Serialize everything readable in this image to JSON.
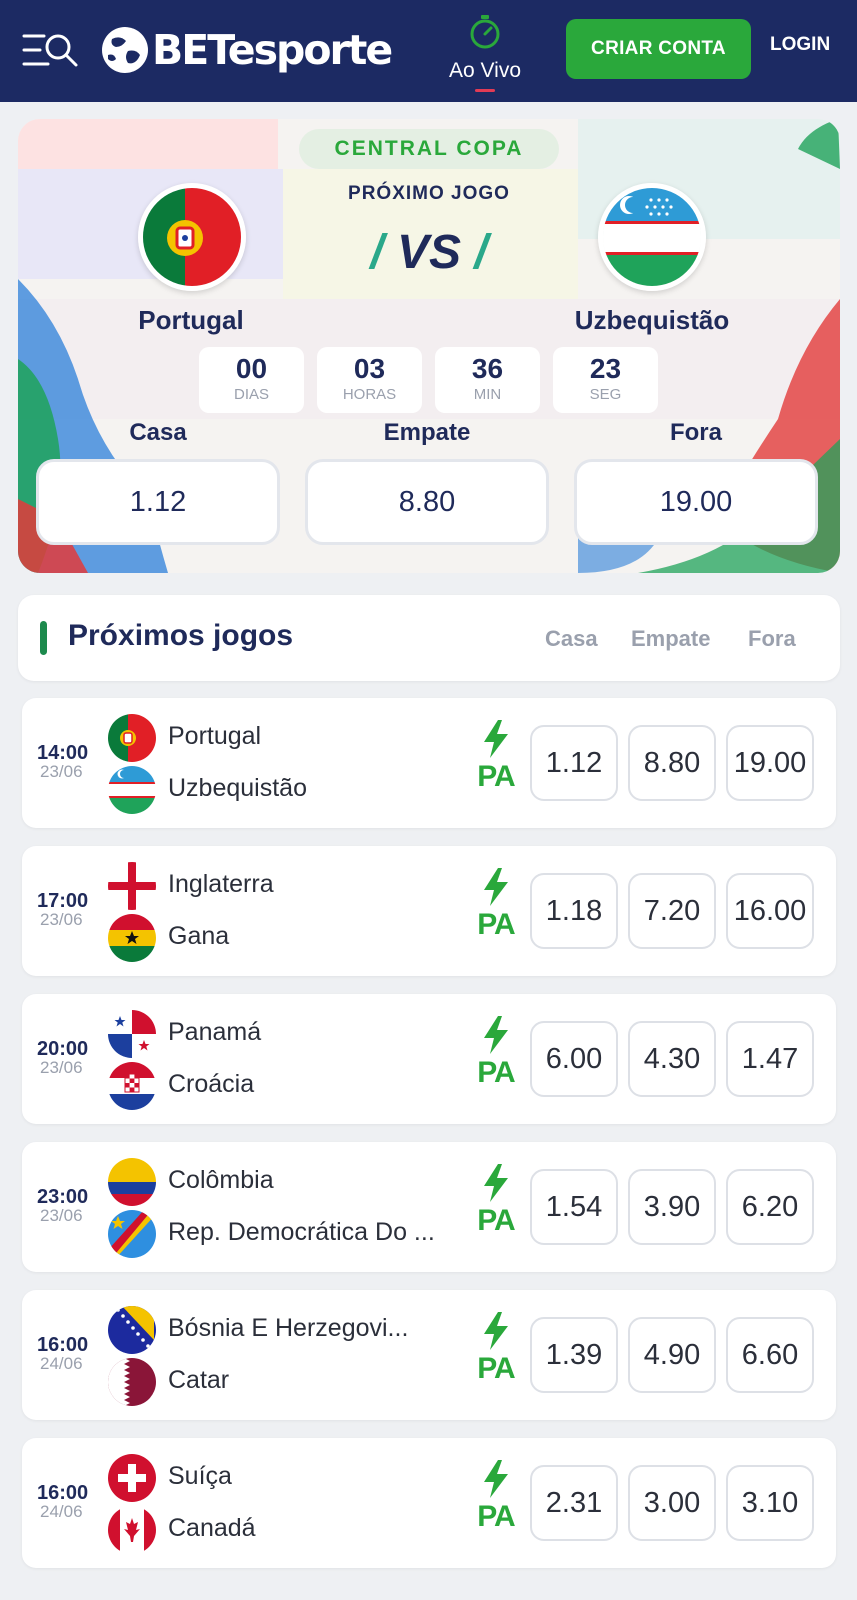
{
  "header": {
    "brand": "BETesporte",
    "live_label": "Ao Vivo",
    "create_account_label": "CRIAR CONTA",
    "login_label": "LOGIN",
    "menu_icon": "menu-search-icon",
    "live_icon": "stopwatch-icon"
  },
  "hero": {
    "badge": "CENTRAL COPA",
    "subtitle": "PRÓXIMO JOGO",
    "vs": "VS",
    "home_team": "Portugal",
    "away_team": "Uzbequistão",
    "countdown": [
      {
        "value": "00",
        "unit": "DIAS"
      },
      {
        "value": "03",
        "unit": "HORAS"
      },
      {
        "value": "36",
        "unit": "MIN"
      },
      {
        "value": "23",
        "unit": "SEG"
      }
    ],
    "odds": [
      {
        "label": "Casa",
        "value": "1.12"
      },
      {
        "label": "Empate",
        "value": "8.80"
      },
      {
        "label": "Fora",
        "value": "19.00"
      }
    ]
  },
  "upcoming": {
    "title": "Próximos jogos",
    "columns": [
      "Casa",
      "Empate",
      "Fora"
    ],
    "pa_label": "PA",
    "matches": [
      {
        "time": "14:00",
        "date": "23/06",
        "home": "Portugal",
        "away": "Uzbequistão",
        "home_flag": "portugal",
        "away_flag": "uzbekistan",
        "odds": [
          "1.12",
          "8.80",
          "19.00"
        ]
      },
      {
        "time": "17:00",
        "date": "23/06",
        "home": "Inglaterra",
        "away": "Gana",
        "home_flag": "england",
        "away_flag": "ghana",
        "odds": [
          "1.18",
          "7.20",
          "16.00"
        ]
      },
      {
        "time": "20:00",
        "date": "23/06",
        "home": "Panamá",
        "away": "Croácia",
        "home_flag": "panama",
        "away_flag": "croatia",
        "odds": [
          "6.00",
          "4.30",
          "1.47"
        ]
      },
      {
        "time": "23:00",
        "date": "23/06",
        "home": "Colômbia",
        "away": "Rep. Democrática Do ...",
        "home_flag": "colombia",
        "away_flag": "dr-congo",
        "odds": [
          "1.54",
          "3.90",
          "6.20"
        ]
      },
      {
        "time": "16:00",
        "date": "24/06",
        "home": "Bósnia E Herzegovi...",
        "away": "Catar",
        "home_flag": "bosnia",
        "away_flag": "qatar",
        "odds": [
          "1.39",
          "4.90",
          "6.60"
        ]
      },
      {
        "time": "16:00",
        "date": "24/06",
        "home": "Suíça",
        "away": "Canadá",
        "home_flag": "switzerland",
        "away_flag": "canada",
        "odds": [
          "2.31",
          "3.00",
          "3.10"
        ]
      }
    ]
  },
  "colors": {
    "header_bg": "#1c2a63",
    "accent_green": "#2aa83b",
    "navy_text": "#1f2a5a",
    "live_underline": "#e23b55"
  }
}
